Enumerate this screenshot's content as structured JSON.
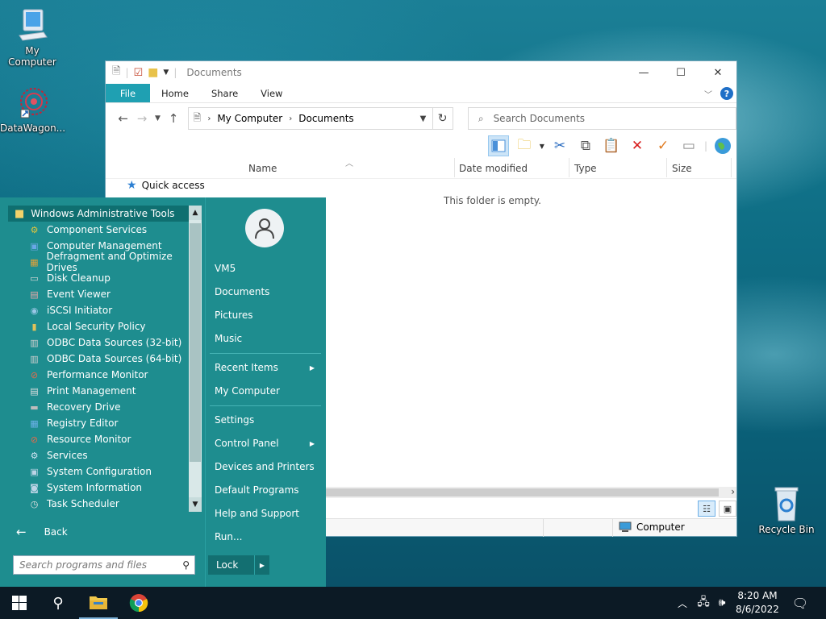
{
  "desktop": {
    "icons": [
      {
        "label": "My Computer",
        "icon": "computer-icon"
      },
      {
        "label": "DataWagon...",
        "icon": "datawagon-icon"
      },
      {
        "label": "Recycle Bin",
        "icon": "recycle-bin-icon"
      }
    ]
  },
  "explorer": {
    "title": "Documents",
    "tabs": [
      "File",
      "Home",
      "Share",
      "View"
    ],
    "address": {
      "root": "My Computer",
      "current": "Documents"
    },
    "search_placeholder": "Search Documents",
    "sidebar": {
      "quick_access": "Quick access"
    },
    "columns": [
      "Name",
      "Date modified",
      "Type",
      "Size"
    ],
    "empty_text": "This folder is empty.",
    "status_location": "Computer"
  },
  "start_menu": {
    "folder": "Windows Administrative Tools",
    "programs": [
      {
        "label": "Component Services",
        "icon": "component-services-icon"
      },
      {
        "label": "Computer Management",
        "icon": "computer-management-icon"
      },
      {
        "label": "Defragment and Optimize Drives",
        "icon": "defragment-icon"
      },
      {
        "label": "Disk Cleanup",
        "icon": "disk-cleanup-icon"
      },
      {
        "label": "Event Viewer",
        "icon": "event-viewer-icon"
      },
      {
        "label": "iSCSI Initiator",
        "icon": "iscsi-icon"
      },
      {
        "label": "Local Security Policy",
        "icon": "security-policy-icon"
      },
      {
        "label": "ODBC Data Sources (32-bit)",
        "icon": "odbc-icon"
      },
      {
        "label": "ODBC Data Sources (64-bit)",
        "icon": "odbc-icon"
      },
      {
        "label": "Performance Monitor",
        "icon": "performance-icon"
      },
      {
        "label": "Print Management",
        "icon": "printer-icon"
      },
      {
        "label": "Recovery Drive",
        "icon": "recovery-drive-icon"
      },
      {
        "label": "Registry Editor",
        "icon": "registry-icon"
      },
      {
        "label": "Resource Monitor",
        "icon": "resource-monitor-icon"
      },
      {
        "label": "Services",
        "icon": "services-icon"
      },
      {
        "label": "System Configuration",
        "icon": "system-config-icon"
      },
      {
        "label": "System Information",
        "icon": "system-info-icon"
      },
      {
        "label": "Task Scheduler",
        "icon": "task-scheduler-icon"
      }
    ],
    "back_label": "Back",
    "search_placeholder": "Search programs and files",
    "right_links": {
      "user": "VM5",
      "documents": "Documents",
      "pictures": "Pictures",
      "music": "Music",
      "recent_items": "Recent Items",
      "my_computer": "My Computer",
      "settings": "Settings",
      "control_panel": "Control Panel",
      "devices_printers": "Devices and Printers",
      "default_programs": "Default Programs",
      "help_support": "Help and Support",
      "run": "Run..."
    },
    "lock_label": "Lock"
  },
  "taskbar": {
    "time": "8:20 AM",
    "date": "8/6/2022"
  },
  "colors": {
    "start_menu_bg": "#1e8d8f",
    "file_tab": "#1fa0b2",
    "taskbar": "#0c1a25"
  }
}
